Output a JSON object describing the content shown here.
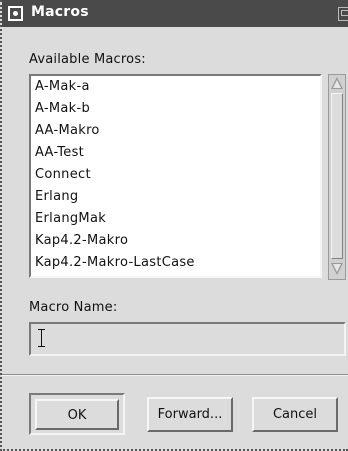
{
  "window": {
    "title": "Macros",
    "menu_icon": "window-menu-icon",
    "maximize_icon": "maximize-icon"
  },
  "available": {
    "label": "Available Macros:",
    "items": [
      "A-Mak-a",
      "A-Mak-b",
      "AA-Makro",
      "AA-Test",
      "Connect",
      "Erlang",
      "ErlangMak",
      "Kap4.2-Makro",
      "Kap4.2-Makro-LastCase"
    ]
  },
  "macro_name": {
    "label": "Macro Name:",
    "value": ""
  },
  "buttons": {
    "ok": "OK",
    "forward": "Forward...",
    "cancel": "Cancel"
  },
  "colors": {
    "titlebar": "#4a4a4a",
    "dialog_bg": "#dcdcdc",
    "list_bg": "#ffffff"
  }
}
